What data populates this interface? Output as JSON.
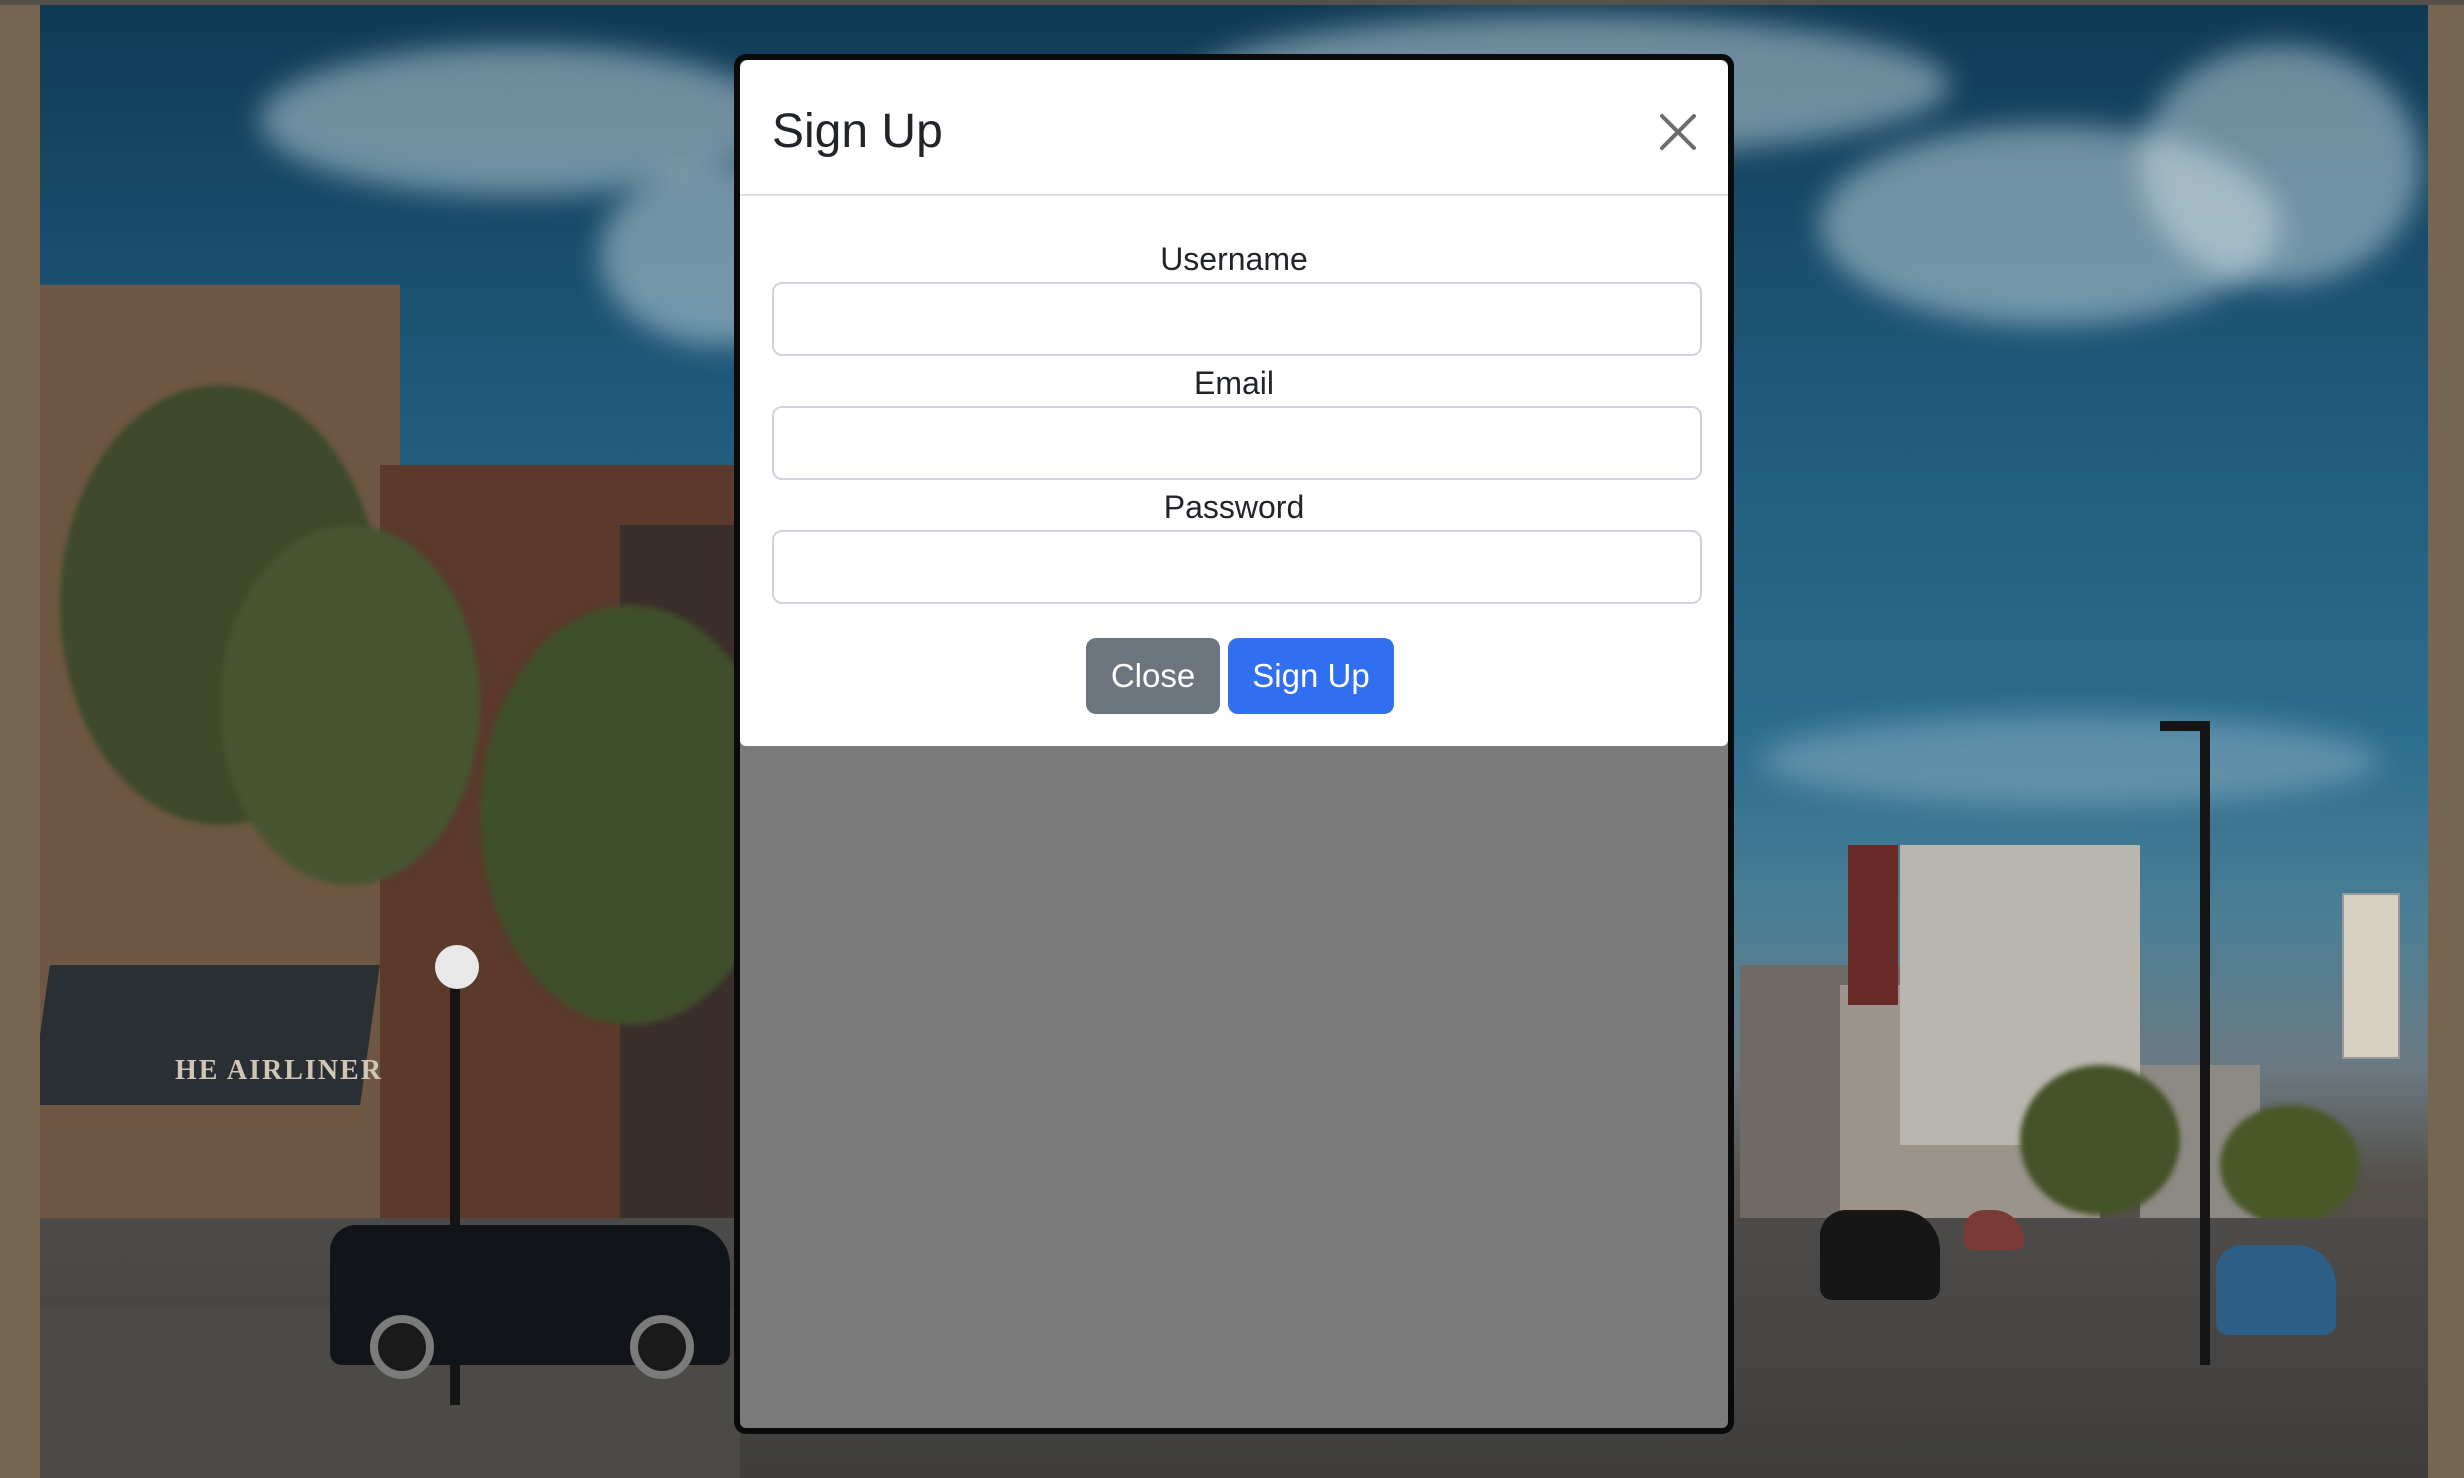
{
  "modal": {
    "title": "Sign Up",
    "close_icon": "close-icon",
    "fields": [
      {
        "label": "Username",
        "value": "",
        "placeholder": ""
      },
      {
        "label": "Email",
        "value": "",
        "placeholder": ""
      },
      {
        "label": "Password",
        "value": "",
        "placeholder": ""
      }
    ],
    "buttons": {
      "close_label": "Close",
      "signup_label": "Sign Up"
    }
  },
  "background": {
    "storefront_sign": "HE AIRLINER"
  },
  "colors": {
    "primary": "#2f6ff0",
    "secondary": "#6c757d",
    "modal_bg": "#ffffff",
    "modal_body_gray": "#7a7a7a"
  }
}
